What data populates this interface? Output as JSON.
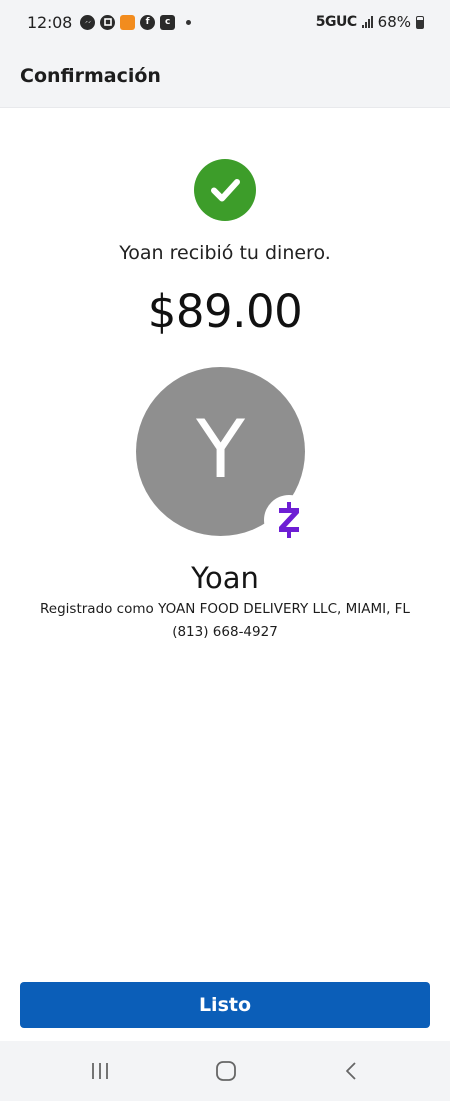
{
  "status_bar": {
    "time": "12:08",
    "notif_icons": [
      "messenger-icon",
      "chase-icon",
      "app-icon",
      "facebook-icon",
      "c-icon"
    ],
    "network": "5GUC",
    "battery": "68%"
  },
  "header": {
    "title": "Confirmación"
  },
  "confirmation": {
    "message": "Yoan recibió tu dinero.",
    "amount": "$89.00",
    "avatar_initial": "Y",
    "recipient_name": "Yoan",
    "registered_as": "Registrado como YOAN FOOD DELIVERY LLC, MIAMI, FL",
    "phone": "(813) 668-4927",
    "success_color": "#3d9d2a",
    "zelle_color": "#6d1ed4"
  },
  "actions": {
    "done_label": "Listo",
    "done_color": "#0b5eb8"
  },
  "nav": {
    "icons": [
      "recent-apps-icon",
      "home-icon",
      "back-icon"
    ]
  }
}
